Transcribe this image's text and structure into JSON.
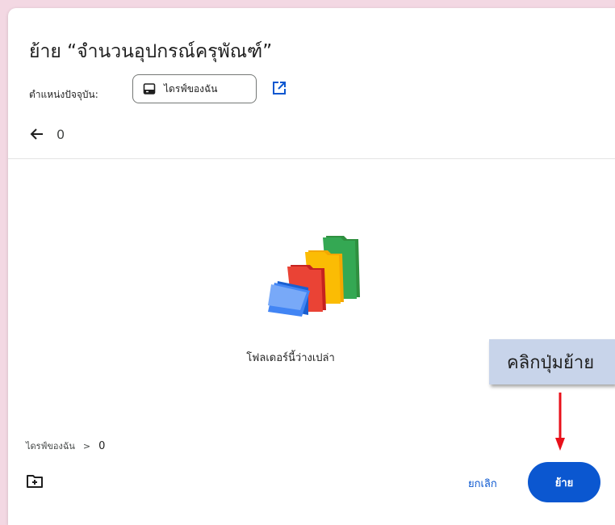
{
  "dialog": {
    "title": "ย้าย “จำนวนอุปกรณ์ครุพัณฑ์”",
    "current_location_label": "ตำแหน่งปัจจุบัน:",
    "current_location_value": "ไดรฟ์ของฉัน",
    "folder_name": "0",
    "empty_message": "โฟลเดอร์นี้ว่างเปล่า",
    "breadcrumb": {
      "root": "ไดรฟ์ของฉัน",
      "separator": ">",
      "current": "0"
    },
    "cancel_label": "ยกเลิก",
    "move_label": "ย้าย"
  },
  "annotation": {
    "callout_text": "คลิกปุ่มย้าย",
    "arrow_color": "#e8101a"
  },
  "colors": {
    "accent": "#0b57d0",
    "folder_blue": "#4285f4",
    "folder_red": "#ea4335",
    "folder_yellow": "#fbbc04",
    "folder_green": "#34a853"
  },
  "icons": [
    "drive-icon",
    "open-in-new-icon",
    "back-arrow-icon",
    "new-folder-icon",
    "empty-folder-illustration"
  ]
}
